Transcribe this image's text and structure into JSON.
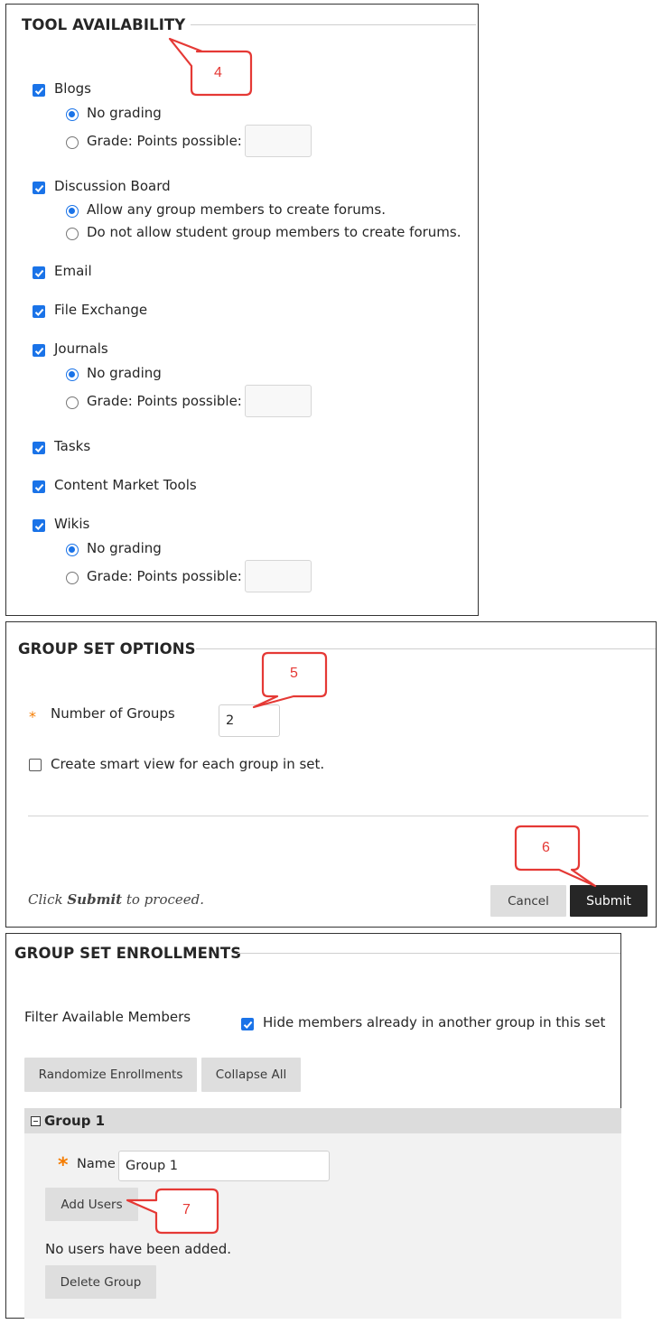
{
  "tool_availability": {
    "title": "TOOL AVAILABILITY",
    "callout": "4",
    "blogs": {
      "label": "Blogs",
      "checked": true,
      "options": [
        "No grading",
        "Grade: Points possible:"
      ]
    },
    "discussion_board": {
      "label": "Discussion Board",
      "checked": true,
      "options": [
        "Allow any group members to create forums.",
        "Do not allow student group members to create forums."
      ]
    },
    "email": {
      "label": "Email",
      "checked": true
    },
    "file_exchange": {
      "label": "File Exchange",
      "checked": true
    },
    "journals": {
      "label": "Journals",
      "checked": true,
      "options": [
        "No grading",
        "Grade: Points possible:"
      ]
    },
    "tasks": {
      "label": "Tasks",
      "checked": true
    },
    "content_market": {
      "label": "Content Market Tools",
      "checked": true
    },
    "wikis": {
      "label": "Wikis",
      "checked": true,
      "options": [
        "No grading",
        "Grade: Points possible:"
      ]
    }
  },
  "group_set_options": {
    "title": "GROUP SET OPTIONS",
    "callout_field": "5",
    "callout_submit": "6",
    "required_mark": "*",
    "number_of_groups_label": "Number of Groups",
    "number_of_groups_value": "2",
    "smart_view_label": "Create smart view for each group in set.",
    "smart_view_checked": false,
    "hint_prefix": "Click",
    "hint_bold": "Submit",
    "hint_suffix": "to proceed.",
    "cancel_label": "Cancel",
    "submit_label": "Submit"
  },
  "group_set_enrollments": {
    "title": "GROUP SET ENROLLMENTS",
    "filter_label": "Filter Available Members",
    "hide_members_label": "Hide members already in another group in this set",
    "hide_members_checked": true,
    "randomize_label": "Randomize Enrollments",
    "collapse_label": "Collapse All",
    "group": {
      "toggle": "−",
      "title": "Group 1",
      "required_mark": "*",
      "name_label": "Name",
      "name_value": "Group 1",
      "add_users_label": "Add Users",
      "callout": "7",
      "empty_text": "No users have been added.",
      "delete_label": "Delete Group"
    }
  },
  "colors": {
    "accent": "#1a73e8",
    "callout_red": "#e53935",
    "required_orange": "#f57c00",
    "submit_dark": "#262626",
    "button_grey": "#dedede"
  }
}
